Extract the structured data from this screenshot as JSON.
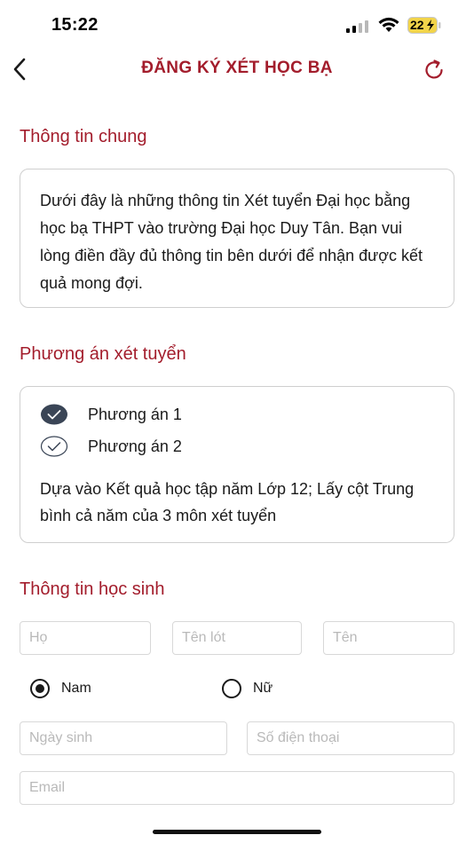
{
  "status_bar": {
    "time": "15:22",
    "battery": "22"
  },
  "header": {
    "title": "ĐĂNG KÝ XÉT HỌC BẠ",
    "back_icon": "chevron-left-icon",
    "refresh_icon": "refresh-icon"
  },
  "general_info": {
    "title": "Thông tin chung",
    "text": "Dưới đây là những thông tin Xét tuyển Đại học bằng học bạ THPT vào trường Đại học Duy Tân. Bạn vui lòng điền đầy đủ thông tin bên dưới để nhận được kết quả mong đợi."
  },
  "admission": {
    "title": "Phương án xét tuyển",
    "options": [
      {
        "label": "Phương án 1",
        "selected": true
      },
      {
        "label": "Phương án 2",
        "selected": false
      }
    ],
    "description": "Dựa vào Kết quả học tập năm Lớp 12; Lấy cột Trung bình cả năm của 3 môn xét tuyển"
  },
  "student": {
    "title": "Thông tin học sinh",
    "last_name_placeholder": "Họ",
    "middle_name_placeholder": "Tên lót",
    "first_name_placeholder": "Tên",
    "gender_options": [
      {
        "label": "Nam",
        "selected": true
      },
      {
        "label": "Nữ",
        "selected": false
      }
    ],
    "dob_placeholder": "Ngày sinh",
    "phone_placeholder": "Số điện thoại",
    "email_placeholder": "Email"
  },
  "colors": {
    "accent": "#a31d2c",
    "check_filled": "#3a4556",
    "border": "#cfcfcf"
  }
}
